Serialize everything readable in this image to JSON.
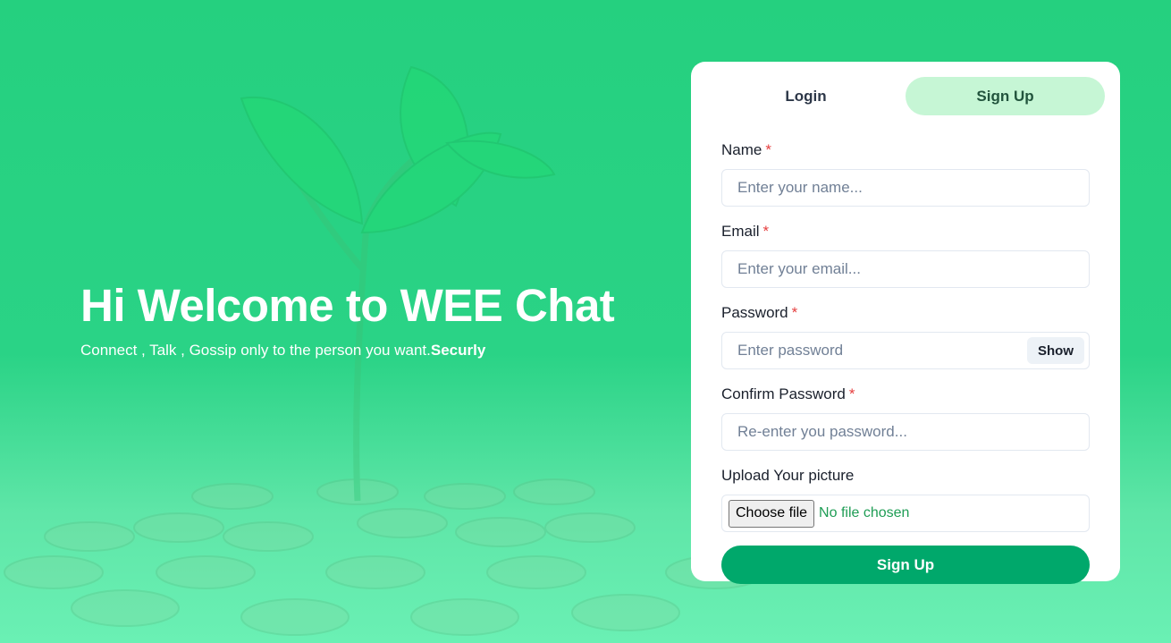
{
  "hero": {
    "title": "Hi Welcome to WEE Chat",
    "subtitle_main": "Connect , Talk , Gossip only to the person you want.",
    "subtitle_bold": "Securly"
  },
  "tabs": [
    {
      "label": "Login",
      "active": false
    },
    {
      "label": "Sign Up",
      "active": true
    }
  ],
  "form": {
    "name": {
      "label": "Name",
      "required": "*",
      "placeholder": "Enter your name..."
    },
    "email": {
      "label": "Email",
      "required": "*",
      "placeholder": "Enter your email..."
    },
    "password": {
      "label": "Password",
      "required": "*",
      "placeholder": "Enter password",
      "toggle_label": "Show"
    },
    "confirm": {
      "label": "Confirm Password",
      "required": "*",
      "placeholder": "Re-enter you password..."
    },
    "picture": {
      "label": "Upload Your picture",
      "button_label": "Choose file",
      "status": "No file chosen"
    },
    "submit_label": "Sign Up"
  },
  "colors": {
    "accent": "#00a86b",
    "active_tab_bg": "#c6f6d5",
    "required": "#e53e3e",
    "background": "#25d07f"
  }
}
